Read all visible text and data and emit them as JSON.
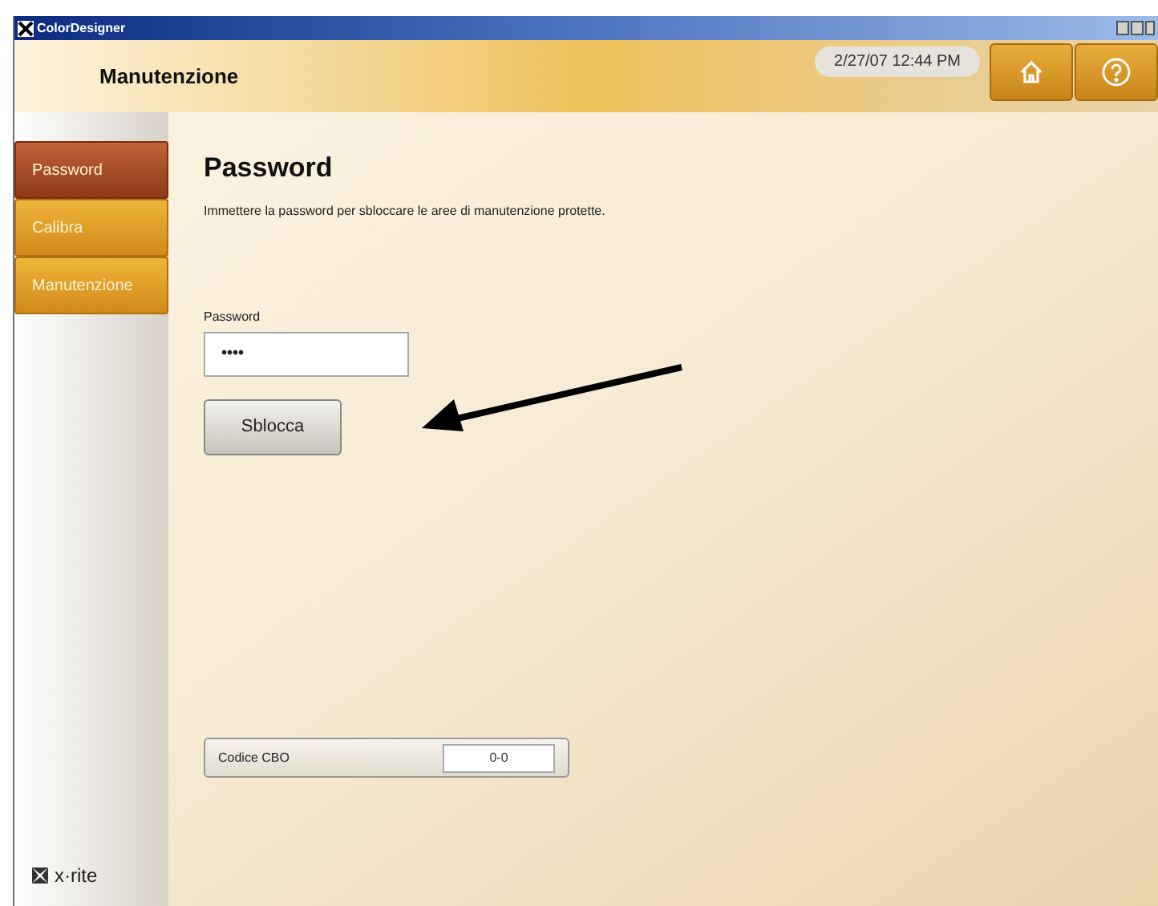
{
  "window": {
    "title": "ColorDesigner"
  },
  "header": {
    "title": "Manutenzione",
    "datetime": "2/27/07 12:44 PM"
  },
  "sidebar": {
    "items": [
      {
        "label": "Password",
        "selected": true
      },
      {
        "label": "Calibra",
        "selected": false
      },
      {
        "label": "Manutenzione",
        "selected": false
      }
    ],
    "logo": "x·rite"
  },
  "content": {
    "heading": "Password",
    "description": "Immettere la password per sbloccare le aree di manutenzione protette.",
    "field_label": "Password",
    "field_value": "••••",
    "button": "Sblocca",
    "code_label": "Codice CBO",
    "code_value": "0-0"
  }
}
